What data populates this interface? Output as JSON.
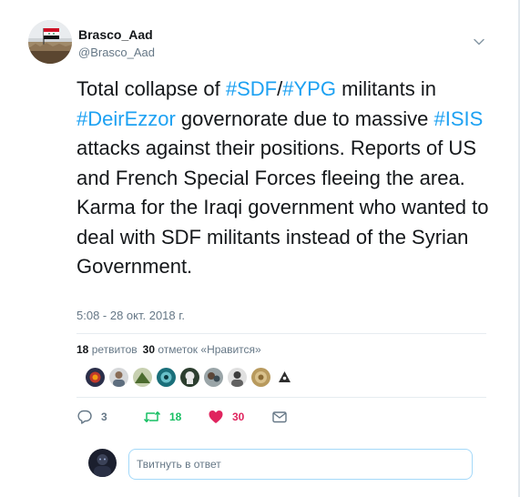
{
  "author": {
    "display_name": "Brasco_Aad",
    "screen_name": "@Brasco_Aad"
  },
  "tweet": {
    "text_parts": [
      {
        "type": "text",
        "value": "Total collapse of "
      },
      {
        "type": "hashtag",
        "value": "#SDF"
      },
      {
        "type": "text",
        "value": "/"
      },
      {
        "type": "hashtag",
        "value": "#YPG"
      },
      {
        "type": "text",
        "value": " militants in "
      },
      {
        "type": "hashtag",
        "value": "#DeirEzzor"
      },
      {
        "type": "text",
        "value": " governorate due to massive "
      },
      {
        "type": "hashtag",
        "value": "#ISIS"
      },
      {
        "type": "text",
        "value": " attacks against their positions. Reports of US and French Special Forces fleeing the area. Karma for the Iraqi government who wanted to deal with SDF militants instead of the Syrian Government."
      }
    ],
    "timestamp": "5:08 - 28 окт. 2018 г."
  },
  "stats": {
    "retweets_count": "18",
    "retweets_label": "ретвитов",
    "likes_count": "30",
    "likes_label": "отметок «Нравится»"
  },
  "likers": [
    {
      "icon": "avatar-1"
    },
    {
      "icon": "avatar-2"
    },
    {
      "icon": "avatar-3"
    },
    {
      "icon": "avatar-4"
    },
    {
      "icon": "avatar-5"
    },
    {
      "icon": "avatar-6"
    },
    {
      "icon": "avatar-7"
    },
    {
      "icon": "avatar-8"
    },
    {
      "icon": "avatar-9"
    }
  ],
  "actions": {
    "reply_count": "3",
    "retweet_count": "18",
    "like_count": "30",
    "reply_icon": "reply-icon",
    "retweet_icon": "retweet-icon",
    "like_icon": "heart-icon",
    "message_icon": "direct-message-icon"
  },
  "composer": {
    "placeholder": "Твитнуть в ответ"
  },
  "colors": {
    "link": "#1da1f2",
    "retweet": "#17bf63",
    "like": "#e0245e",
    "secondary_text": "#657786"
  }
}
